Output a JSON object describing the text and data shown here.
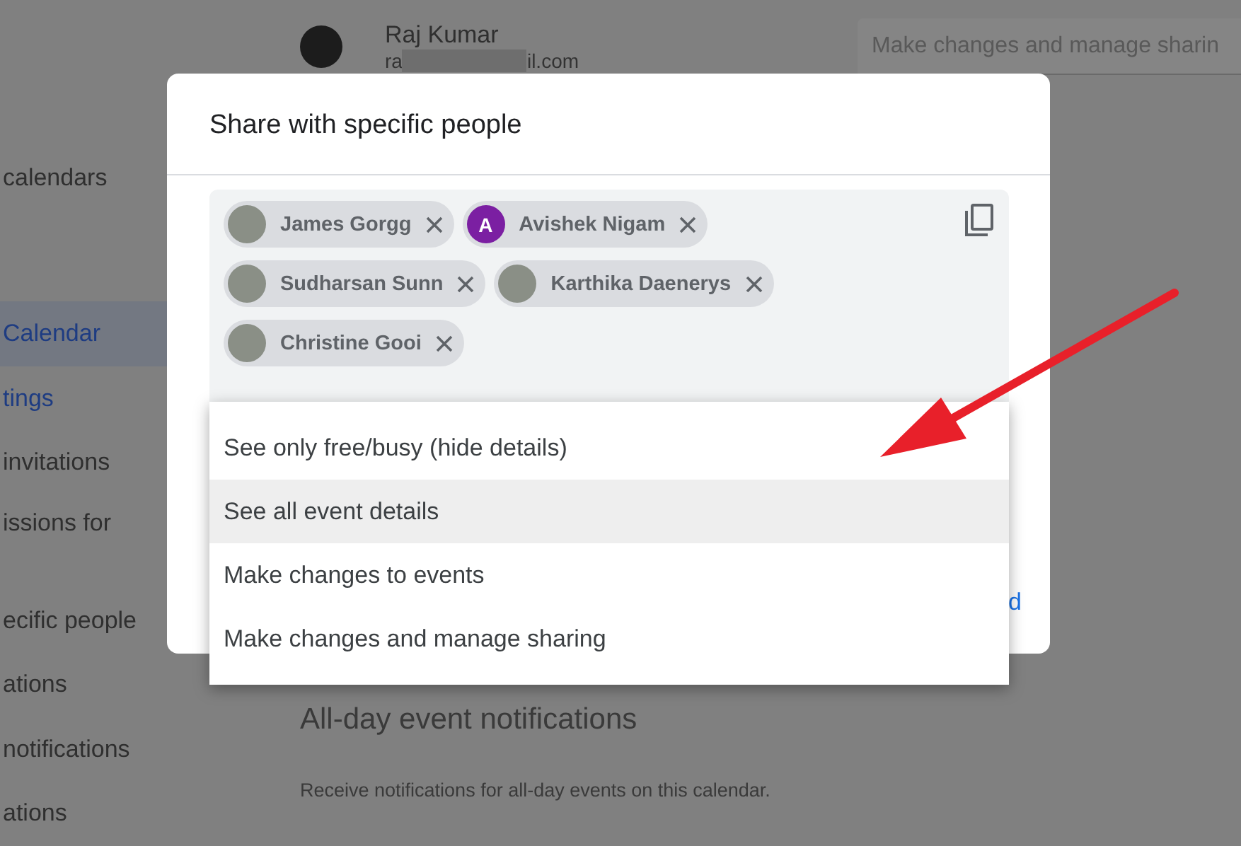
{
  "sidebar": {
    "items": [
      {
        "label": "calendars",
        "selected": false,
        "kind": "heading"
      },
      {
        "label": "Calendar",
        "selected": true,
        "kind": "calendar"
      },
      {
        "label": "tings",
        "selected": false,
        "kind": "link"
      },
      {
        "label": "invitations",
        "selected": false,
        "kind": "item"
      },
      {
        "label": "issions for",
        "selected": false,
        "kind": "item"
      },
      {
        "label": "ecific people",
        "selected": false,
        "kind": "item"
      },
      {
        "label": "ations",
        "selected": false,
        "kind": "item"
      },
      {
        "label": "notifications",
        "selected": false,
        "kind": "item"
      },
      {
        "label": "ations",
        "selected": false,
        "kind": "item"
      }
    ]
  },
  "person": {
    "name": "Raj Kumar",
    "email_start": "ra",
    "email_end": "il.com",
    "permission": "Make changes and manage sharin"
  },
  "section": {
    "title": "All-day event notifications",
    "description": "Receive notifications for all-day events on this calendar."
  },
  "dialog": {
    "title": "Share with specific people",
    "chips": [
      {
        "name": "James Gorgg",
        "kind": "photo"
      },
      {
        "name": "Avishek Nigam",
        "kind": "letter",
        "letter": "A",
        "color": "#7b1fa2"
      },
      {
        "name": "Sudharsan Sunn",
        "kind": "photo"
      },
      {
        "name": "Karthika Daenerys",
        "kind": "photo"
      },
      {
        "name": "Christine Gooi",
        "kind": "photo"
      }
    ],
    "send_fragment": "d"
  },
  "dropdown": {
    "options": [
      {
        "label": "See only free/busy (hide details)",
        "selected": false
      },
      {
        "label": "See all event details",
        "selected": true
      },
      {
        "label": "Make changes to events",
        "selected": false
      },
      {
        "label": "Make changes and manage sharing",
        "selected": false
      }
    ]
  }
}
